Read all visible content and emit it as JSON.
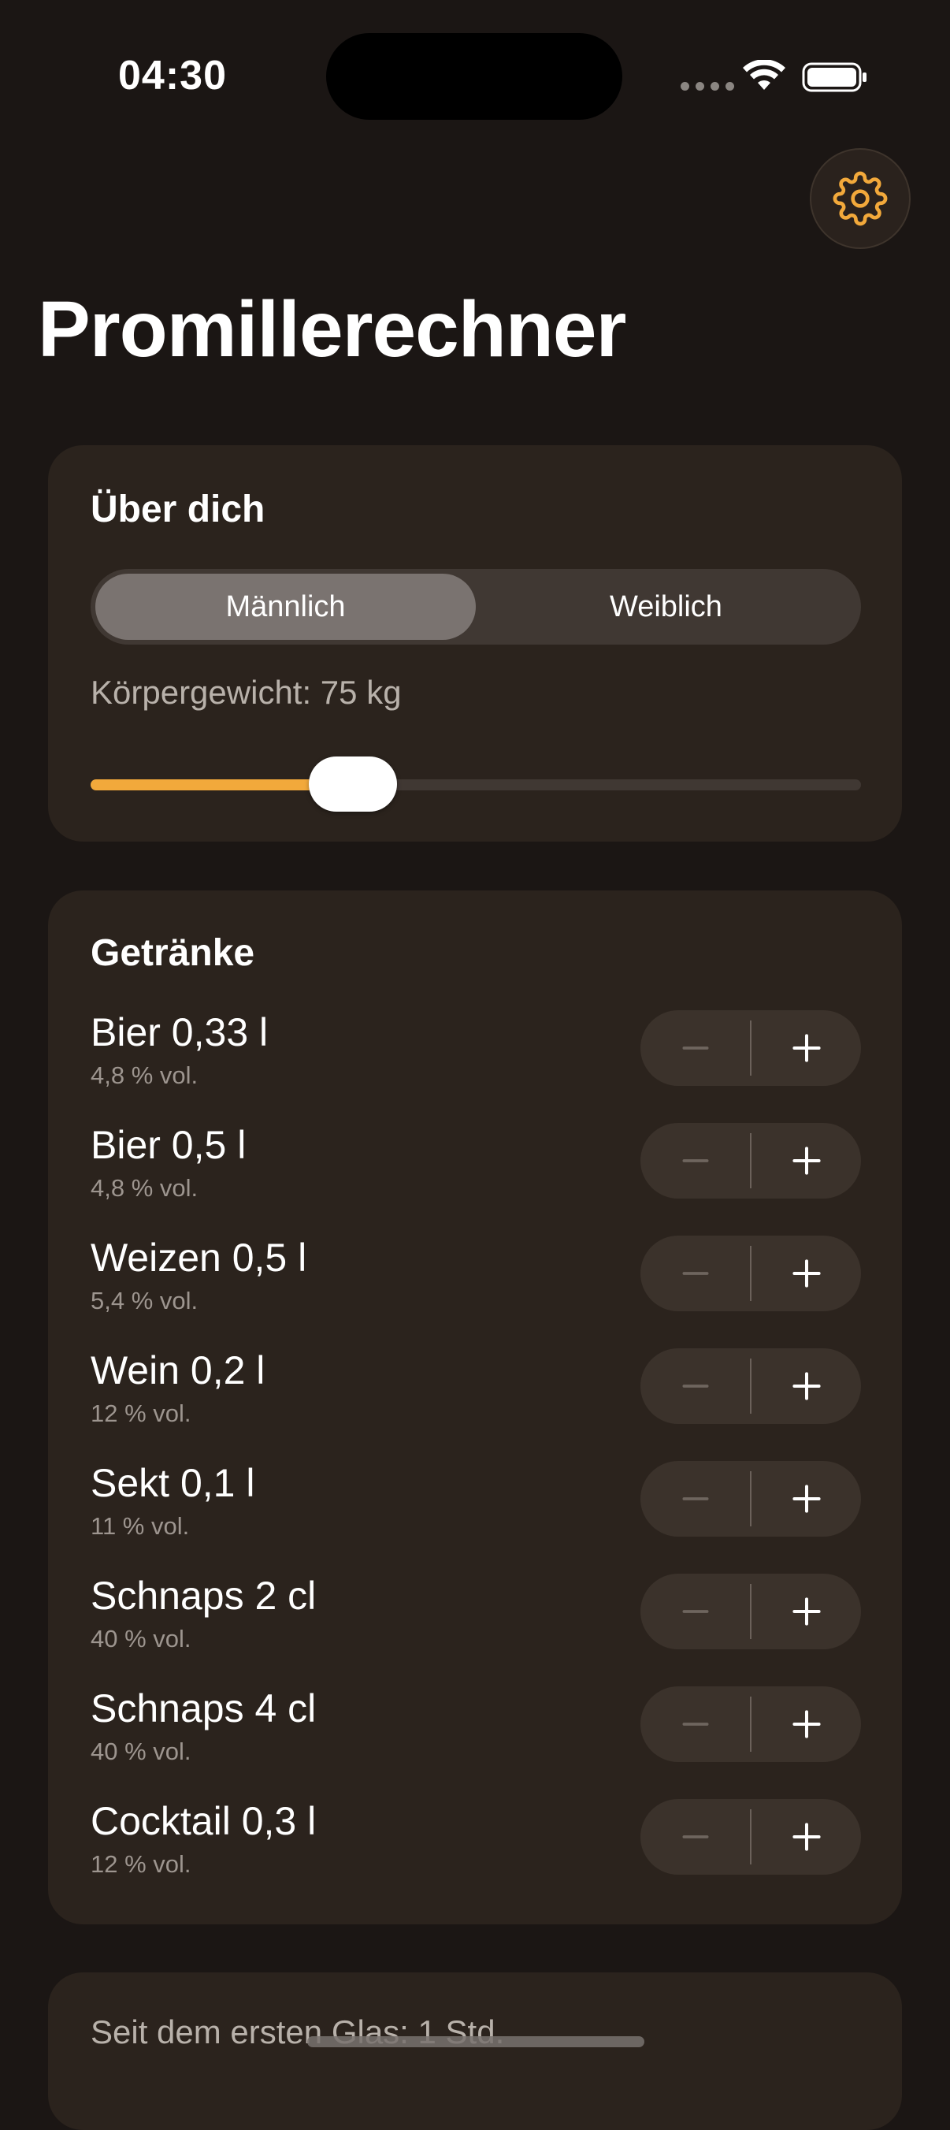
{
  "status_bar": {
    "time": "04:30",
    "icons": [
      "signal-dots-icon",
      "wifi-icon",
      "battery-icon"
    ]
  },
  "header": {
    "title": "Promillerechner",
    "settings_icon": "gear-icon"
  },
  "about": {
    "title": "Über dich",
    "gender_options": [
      "Männlich",
      "Weiblich"
    ],
    "selected_gender": "Männlich",
    "weight_label": "Körpergewicht: 75 kg",
    "weight_slider_fraction": 0.34
  },
  "drinks": {
    "title": "Getränke",
    "items": [
      {
        "name": "Bier 0,33 l",
        "abv": "4,8 % vol."
      },
      {
        "name": "Bier 0,5 l",
        "abv": "4,8 % vol."
      },
      {
        "name": "Weizen 0,5 l",
        "abv": "5,4 % vol."
      },
      {
        "name": "Wein 0,2 l",
        "abv": "12 % vol."
      },
      {
        "name": "Sekt 0,1 l",
        "abv": "11 % vol."
      },
      {
        "name": "Schnaps 2 cl",
        "abv": "40 % vol."
      },
      {
        "name": "Schnaps 4 cl",
        "abv": "40 % vol."
      },
      {
        "name": "Cocktail 0,3 l",
        "abv": "12 % vol."
      }
    ]
  },
  "summary": {
    "time_since_first": "Seit dem ersten Glas: 1 Std."
  },
  "colors": {
    "background": "#1b1614",
    "card": "#2b231d",
    "accent": "#f2a93b",
    "stepper_bg": "#3b322b",
    "muted_text": "#9d958f"
  }
}
